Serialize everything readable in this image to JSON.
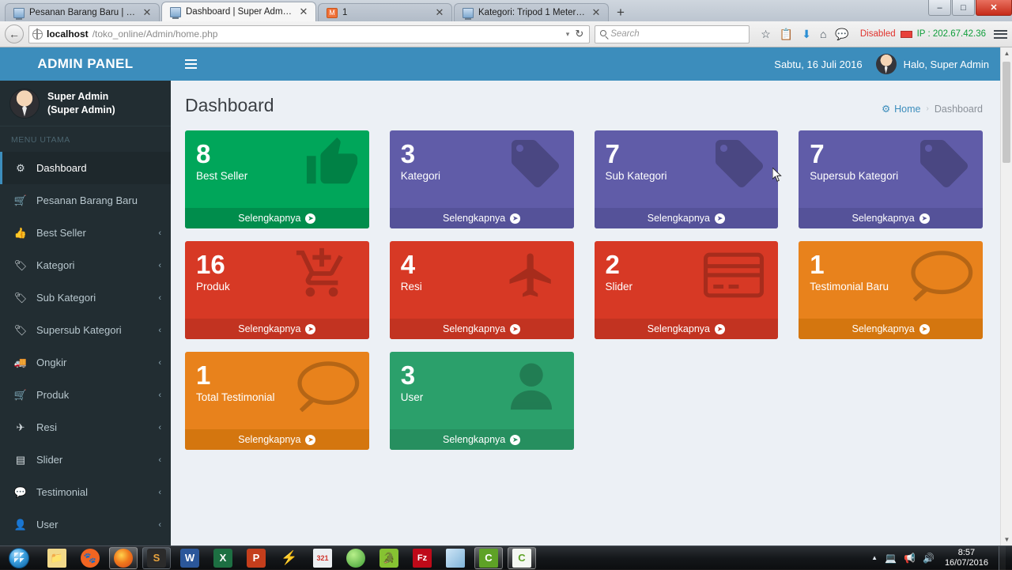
{
  "browser": {
    "tabs": [
      {
        "title": "Pesanan Barang Baru | Sup...",
        "icon": "page-icon",
        "active": false,
        "badge": ""
      },
      {
        "title": "Dashboard | Super Admin ...",
        "icon": "page-icon",
        "active": true,
        "badge": ""
      },
      {
        "title": "1",
        "icon": "orange-icon",
        "active": false,
        "badge": "1"
      },
      {
        "title": "Kategori: Tripod 1 Meter | I...",
        "icon": "page-icon",
        "active": false,
        "badge": ""
      }
    ],
    "new_tab_label": "+",
    "close_label": "✕",
    "window_controls": {
      "minimize": "–",
      "maximize": "□",
      "close": "✕"
    },
    "back_label": "←",
    "url_host": "localhost",
    "url_path": "/toko_online/Admin/home.php",
    "url_caret": "▾",
    "reload_label": "↻",
    "search_placeholder": "Search",
    "toolbar_icons": [
      {
        "name": "bookmark-star-icon",
        "glyph": "☆"
      },
      {
        "name": "reader-list-icon",
        "glyph": "Ὄb"
      },
      {
        "name": "download-icon",
        "glyph": "⬇"
      },
      {
        "name": "home-icon",
        "glyph": "⌂"
      },
      {
        "name": "chat-icon",
        "glyph": "Ὂc"
      }
    ],
    "status_disabled": "Disabled",
    "status_ip": "IP : 202.67.42.36"
  },
  "sidebar": {
    "logo": "ADMIN PANEL",
    "user": {
      "name": "Super Admin",
      "role": "(Super Admin)"
    },
    "menu_header": "MENU UTAMA",
    "items": [
      {
        "label": "Dashboard",
        "icon": "dashboard-icon",
        "icon_glyph": "☸",
        "caret": "",
        "active": true
      },
      {
        "label": "Pesanan Barang Baru",
        "icon": "cart-icon",
        "icon_glyph": "Ὥ2",
        "caret": "",
        "active": false
      },
      {
        "label": "Best Seller",
        "icon": "thumbs-up-icon",
        "icon_glyph": "ὄd",
        "caret": "‹",
        "active": false
      },
      {
        "label": "Kategori",
        "icon": "tag-icon",
        "icon_glyph": "Ἷ7",
        "caret": "‹",
        "active": false
      },
      {
        "label": "Sub Kategori",
        "icon": "tag-icon",
        "icon_glyph": "Ἷ7",
        "caret": "‹",
        "active": false
      },
      {
        "label": "Supersub Kategori",
        "icon": "tag-icon",
        "icon_glyph": "Ἷ7",
        "caret": "‹",
        "active": false
      },
      {
        "label": "Ongkir",
        "icon": "truck-icon",
        "icon_glyph": "Ὡa",
        "caret": "‹",
        "active": false
      },
      {
        "label": "Produk",
        "icon": "cart-icon",
        "icon_glyph": "Ὥ2",
        "caret": "‹",
        "active": false
      },
      {
        "label": "Resi",
        "icon": "plane-icon",
        "icon_glyph": "✈",
        "caret": "‹",
        "active": false
      },
      {
        "label": "Slider",
        "icon": "slider-card-icon",
        "icon_glyph": "▤",
        "caret": "‹",
        "active": false
      },
      {
        "label": "Testimonial",
        "icon": "comments-icon",
        "icon_glyph": "Ὂc",
        "caret": "‹",
        "active": false
      },
      {
        "label": "User",
        "icon": "user-icon",
        "icon_glyph": "὆4",
        "caret": "‹",
        "active": false
      }
    ]
  },
  "topnav": {
    "toggle_name": "sidebar-toggle",
    "date": "Sabtu, 16 Juli 2016",
    "greeting": "Halo, Super Admin"
  },
  "page": {
    "title": "Dashboard",
    "breadcrumb": {
      "home": "Home",
      "separator": "›",
      "current": "Dashboard"
    }
  },
  "cards": [
    {
      "number": "8",
      "label": "Best Seller",
      "more": "Selengkapnya",
      "color": "#00a65a",
      "foot": "#008d4c",
      "icon": "thumbs-up-icon"
    },
    {
      "number": "3",
      "label": "Kategori",
      "more": "Selengkapnya",
      "color": "#605ca8",
      "foot": "#555299",
      "icon": "tags-icon"
    },
    {
      "number": "7",
      "label": "Sub Kategori",
      "more": "Selengkapnya",
      "color": "#605ca8",
      "foot": "#555299",
      "icon": "tags-icon"
    },
    {
      "number": "7",
      "label": "Supersub Kategori",
      "more": "Selengkapnya",
      "color": "#605ca8",
      "foot": "#555299",
      "icon": "tags-icon"
    },
    {
      "number": "16",
      "label": "Produk",
      "more": "Selengkapnya",
      "color": "#d73925",
      "foot": "#c23321",
      "icon": "cart-plus-icon"
    },
    {
      "number": "4",
      "label": "Resi",
      "more": "Selengkapnya",
      "color": "#d73925",
      "foot": "#c23321",
      "icon": "plane-icon"
    },
    {
      "number": "2",
      "label": "Slider",
      "more": "Selengkapnya",
      "color": "#d73925",
      "foot": "#c23321",
      "icon": "credit-card-icon"
    },
    {
      "number": "1",
      "label": "Testimonial Baru",
      "more": "Selengkapnya",
      "color": "#e8821c",
      "foot": "#d4760f",
      "icon": "comment-icon"
    },
    {
      "number": "1",
      "label": "Total Testimonial",
      "more": "Selengkapnya",
      "color": "#e8821c",
      "foot": "#d4760f",
      "icon": "comment-icon"
    },
    {
      "number": "3",
      "label": "User",
      "more": "Selengkapnya",
      "color": "#2ba06b",
      "foot": "#268f5f",
      "icon": "user-icon"
    }
  ],
  "taskbar": {
    "start_name": "start-button",
    "items": [
      {
        "name": "explorer-icon",
        "label": "",
        "bg": "#f2d98a",
        "fg": "#6b5520",
        "running": false
      },
      {
        "name": "uc-browser-icon",
        "label": "",
        "bg": "#f26522",
        "fg": "#fff",
        "running": false
      },
      {
        "name": "firefox-icon",
        "label": "",
        "bg": "#e8701a",
        "fg": "#fff",
        "running": true
      },
      {
        "name": "sublime-icon",
        "label": "S",
        "bg": "#2b2b2b",
        "fg": "#e8a33d",
        "running": true
      },
      {
        "name": "word-icon",
        "label": "W",
        "bg": "#2b579a",
        "fg": "#fff",
        "running": false
      },
      {
        "name": "excel-icon",
        "label": "X",
        "bg": "#1d6f42",
        "fg": "#fff",
        "running": false
      },
      {
        "name": "powerpoint-icon",
        "label": "P",
        "bg": "#c43e1c",
        "fg": "#fff",
        "running": false
      },
      {
        "name": "winamp-icon",
        "label": "",
        "bg": "#d8b018",
        "fg": "#fff",
        "running": false
      },
      {
        "name": "calendar-icon",
        "label": "321",
        "bg": "#eceff2",
        "fg": "#d0342c",
        "running": false
      },
      {
        "name": "idm-icon",
        "label": "",
        "bg": "#4eb84e",
        "fg": "#fff",
        "running": false
      },
      {
        "name": "evernote-icon",
        "label": "",
        "bg": "#86c232",
        "fg": "#fff",
        "running": false
      },
      {
        "name": "filezilla-icon",
        "label": "Fz",
        "bg": "#bf0a19",
        "fg": "#fff",
        "running": false
      },
      {
        "name": "notepad-icon",
        "label": "",
        "bg": "#9dc9e8",
        "fg": "#fff",
        "running": false
      },
      {
        "name": "camtasia-icon",
        "label": "C",
        "bg": "#5ea226",
        "fg": "#fff",
        "running": true
      },
      {
        "name": "camtasia-editor-icon",
        "label": "C",
        "bg": "#f4f7f2",
        "fg": "#5ea226",
        "running": true
      }
    ],
    "tray": {
      "show_hidden": "▲",
      "network_icon": "network-icon",
      "action_icon": "action-center-icon",
      "volume_icon": "volume-icon",
      "time": "8:57",
      "date": "16/07/2016"
    }
  }
}
